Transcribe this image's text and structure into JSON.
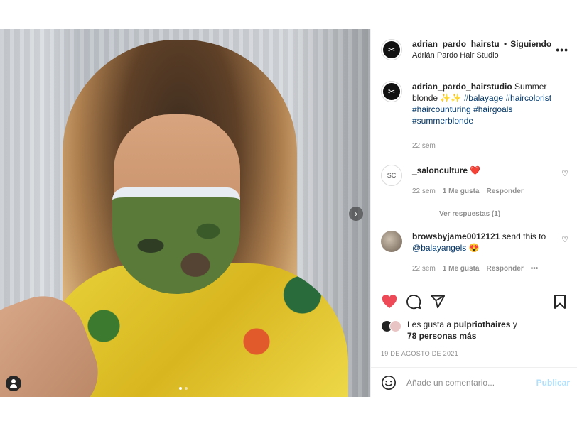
{
  "post": {
    "username": "adrian_pardo_hairstudio",
    "username_truncated": "adrian_pardo_hairstuc",
    "separator": "•",
    "follow_status": "Siguiendo",
    "location": "Adrián Pardo Hair Studio",
    "more_icon": "•••",
    "avatar_glyph": "✂",
    "carousel": {
      "current": 1,
      "total": 2
    }
  },
  "caption": {
    "username": "adrian_pardo_hairstudio",
    "text": " Summer blonde ✨✨",
    "hashtags": [
      "#balayage",
      "#haircolorist",
      "#haircounturing",
      "#hairgoals",
      "#summerblonde"
    ],
    "time": "22 sem"
  },
  "comments": [
    {
      "username": "_salonculture",
      "avatar_text": "SC",
      "text": "",
      "emoji": "❤️",
      "time": "22 sem",
      "likes": "1 Me gusta",
      "reply": "Responder",
      "view_replies": "Ver respuestas (1)"
    },
    {
      "username": "browsbyjame0012121",
      "text": " send this to",
      "mention": "@balayangels",
      "emoji": "😍",
      "time": "22 sem",
      "likes": "1 Me gusta",
      "reply": "Responder",
      "more": "•••"
    }
  ],
  "likes": {
    "prefix": "Les gusta a ",
    "user": "pulpriothaires",
    "suffix": " y",
    "others": "78 personas más"
  },
  "date": "19 DE AGOSTO DE 2021",
  "add_comment": {
    "placeholder": "Añade un comentario...",
    "publish": "Publicar"
  },
  "colors": {
    "like_red": "#ed4956",
    "link_blue": "#00376b",
    "publish_disabled": "#b2dffc",
    "muted": "#8e8e8e"
  },
  "icons": [
    "heart-icon",
    "comment-icon",
    "share-icon",
    "bookmark-icon",
    "emoji-icon",
    "chevron-right-icon",
    "user-tag-icon"
  ]
}
